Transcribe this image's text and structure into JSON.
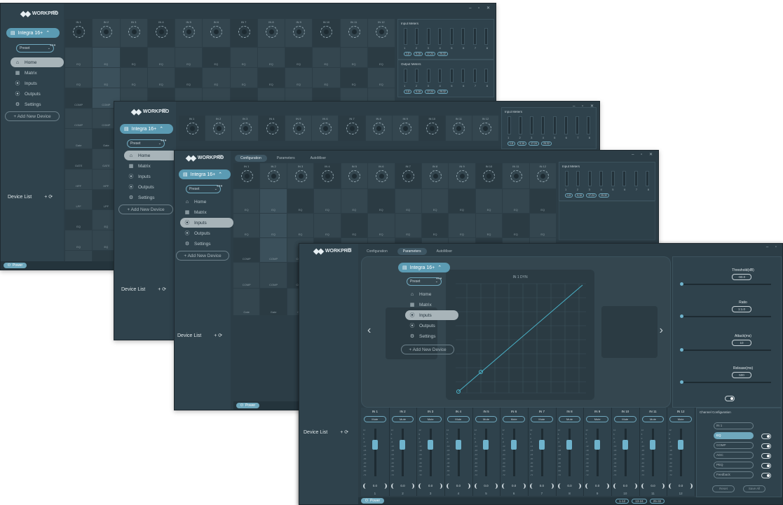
{
  "app": {
    "logo_text": "WORKPRO",
    "device_name": "Integra 16+",
    "preset": "Preset",
    "add_device": "+ Add New Device",
    "device_list": "Device List",
    "power": "Power",
    "window_controls": "– ▫ ✕"
  },
  "nav": [
    {
      "label": "Home",
      "icon": "home-icon"
    },
    {
      "label": "Matrix",
      "icon": "matrix-icon"
    },
    {
      "label": "Inputs",
      "icon": "input-icon"
    },
    {
      "label": "Outputs",
      "icon": "output-icon"
    },
    {
      "label": "Settings",
      "icon": "gear-icon"
    }
  ],
  "tabs": [
    "Configuration",
    "Parameters",
    "AutoMixer"
  ],
  "channels": [
    "IN 1",
    "IN 2",
    "IN 3",
    "IN 4",
    "IN 5",
    "IN 6",
    "IN 7",
    "IN 8",
    "IN 9",
    "IN 10",
    "IN 11",
    "IN 12"
  ],
  "row_labels": [
    "EQ",
    "EQ",
    "COMP",
    "COMP",
    "Gate",
    "GATE",
    "HPF",
    "LPF"
  ],
  "meters": {
    "input_title": "Input Meters",
    "output_title": "Output Meters",
    "numbers": [
      "1",
      "2",
      "3",
      "4",
      "5",
      "6",
      "7",
      "8"
    ],
    "pages": [
      "1-8",
      "9-16",
      "17-24",
      "25-32"
    ]
  },
  "bottom_strip": {
    "names": [
      "IN 1",
      "IN 2",
      "IN 3",
      "IN 4",
      "IN 5",
      "IN 6",
      "IN 7",
      "IN 8",
      "IN 9",
      "IN 10",
      "IN 11",
      "IN 12"
    ],
    "mute": "Mute",
    "values": [
      "0.0",
      "0.0",
      "0.0",
      "0.0",
      "0.0",
      "0.0",
      "0.0",
      "0.0",
      "0.0",
      "0.0",
      "0.0",
      "0.0"
    ],
    "numbers": [
      "1",
      "2",
      "3",
      "4",
      "5",
      "6",
      "7",
      "8",
      "9",
      "10",
      "11",
      "12"
    ],
    "scale": [
      "12",
      "6",
      "0",
      "-6",
      "-12",
      "-18",
      "-24",
      "-30",
      "-40",
      "-50",
      "-60",
      "-72"
    ]
  },
  "parameters": {
    "graph_title": "IN 1 DYN",
    "threshold_label": "Threshold(dB)",
    "threshold_value": "-90.0",
    "ratio_label": "Ratio",
    "ratio_value": "1:1.0",
    "attack_label": "Attack(ms)",
    "attack_value": "10",
    "release_label": "Release(ms)",
    "release_value": "500",
    "channel_config": "Channel Configuration",
    "cc_rows": [
      "IN 1",
      "EQ",
      "COMP",
      "AGC",
      "PEQ",
      "Feedback"
    ],
    "reset": "Reset",
    "save_all": "Save All"
  },
  "pages_footer": [
    "1-12",
    "13-24",
    "25-32"
  ],
  "colors": {
    "accent": "#6fa8bd",
    "panel": "#2c3d46",
    "active_nav": "#a8b4b9"
  }
}
